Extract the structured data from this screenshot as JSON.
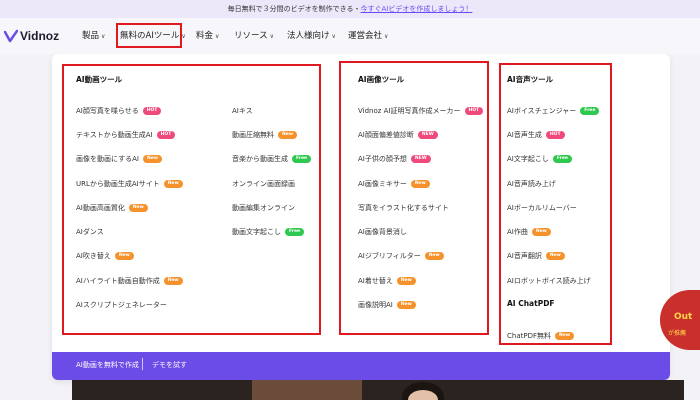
{
  "banner": {
    "text": "毎日無料で３分間のビデオを制作できる・",
    "link": "今すぐAIビデオを作成しましょう！"
  },
  "brand": {
    "name": "Vidnoz"
  },
  "nav": [
    {
      "label": "製品"
    },
    {
      "label": "無料のAIツール"
    },
    {
      "label": "料金"
    },
    {
      "label": "リソース"
    },
    {
      "label": "法人様向け"
    },
    {
      "label": "運営会社"
    }
  ],
  "columns": {
    "video": {
      "title": "AI動画ツール",
      "left": [
        {
          "label": "AI顔写真を喋らせる",
          "badge": "HOT"
        },
        {
          "label": "テキストから動画生成AI",
          "badge": "HOT"
        },
        {
          "label": "画像を動画にするAI",
          "badge": "New"
        },
        {
          "label": "URLから動画生成AIサイト",
          "badge": "New"
        },
        {
          "label": "AI動画高画質化",
          "badge": "New"
        },
        {
          "label": "AIダンス",
          "badge": ""
        },
        {
          "label": "AI吹き替え",
          "badge": "New"
        },
        {
          "label": "AIハイライト動画自動作成",
          "badge": "New"
        },
        {
          "label": "AIスクリプトジェネレーター",
          "badge": ""
        }
      ],
      "right": [
        {
          "label": "AIキス",
          "badge": ""
        },
        {
          "label": "動画圧縮無料",
          "badge": "New"
        },
        {
          "label": "音楽から動画生成",
          "badge": "Free"
        },
        {
          "label": "オンライン画面録画",
          "badge": ""
        },
        {
          "label": "動画編集オンライン",
          "badge": ""
        },
        {
          "label": "動画文字起こし",
          "badge": "Free"
        }
      ]
    },
    "image": {
      "title": "AI画像ツール",
      "items": [
        {
          "label": "Vidnoz AI証明写真作成メーカー",
          "badge": "HOT"
        },
        {
          "label": "AI顔面偏差値診断",
          "badge": "NEW"
        },
        {
          "label": "AI子供の顔予想",
          "badge": "NEW"
        },
        {
          "label": "AI画像ミキサー",
          "badge": "New"
        },
        {
          "label": "写真をイラスト化するサイト",
          "badge": ""
        },
        {
          "label": "AI画像背景消し",
          "badge": ""
        },
        {
          "label": "AIジブリフィルター",
          "badge": "New"
        },
        {
          "label": "AI着せ替え",
          "badge": "New"
        },
        {
          "label": "画像説明AI",
          "badge": "New"
        }
      ]
    },
    "audio": {
      "title": "AI音声ツール",
      "items": [
        {
          "label": "AIボイスチェンジャー",
          "badge": "Free"
        },
        {
          "label": "AI音声生成",
          "badge": "HOT"
        },
        {
          "label": "AI文字起こし",
          "badge": "Free"
        },
        {
          "label": "AI音声読み上げ",
          "badge": ""
        },
        {
          "label": "AIボーカルリムーバー",
          "badge": ""
        },
        {
          "label": "AI作曲",
          "badge": "New"
        },
        {
          "label": "AI音声翻訳",
          "badge": "New"
        },
        {
          "label": "AIロボットボイス読み上げ",
          "badge": ""
        }
      ],
      "subtitle": "AI ChatPDF",
      "extra": [
        {
          "label": "ChatPDF無料",
          "badge": "New"
        }
      ]
    }
  },
  "footer": {
    "left": "AI動画を無料で作成",
    "right": "デモを試す"
  },
  "side_badge": {
    "text": "Out",
    "promo": "が推薦"
  },
  "colors": {
    "accent": "#6b4ce6",
    "highlight": "#e0191f",
    "hot": "#f04a7c",
    "new": "#f5922b",
    "free": "#2ec94e"
  }
}
